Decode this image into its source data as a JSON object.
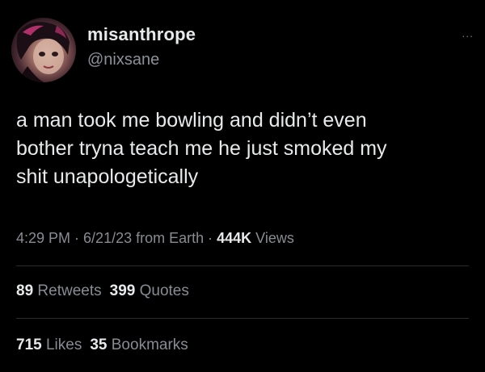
{
  "author": {
    "display_name": "misanthrope",
    "handle": "@nixsane",
    "avatar_icon": "profile-avatar"
  },
  "more_options": "...",
  "tweet": {
    "text": "a man took me bowling and didn’t even\nbother tryna teach me he just smoked my\nshit unapologetically"
  },
  "meta": {
    "time": "4:29 PM",
    "sep1": " · ",
    "date": "6/21/23",
    "source": " from Earth",
    "sep2": " · ",
    "views_count": "444K",
    "views_label": " Views"
  },
  "stats_row_1": {
    "retweets_count": "89",
    "retweets_label": " Retweets",
    "quotes_count": "399",
    "quotes_label": " Quotes"
  },
  "stats_row_2": {
    "likes_count": "715",
    "likes_label": " Likes",
    "bookmarks_count": "35",
    "bookmarks_label": " Bookmarks"
  },
  "colors": {
    "background": "#000000",
    "primary_text": "#e7e9ea",
    "secondary_text": "#878c91",
    "divider": "#2a2d30"
  }
}
